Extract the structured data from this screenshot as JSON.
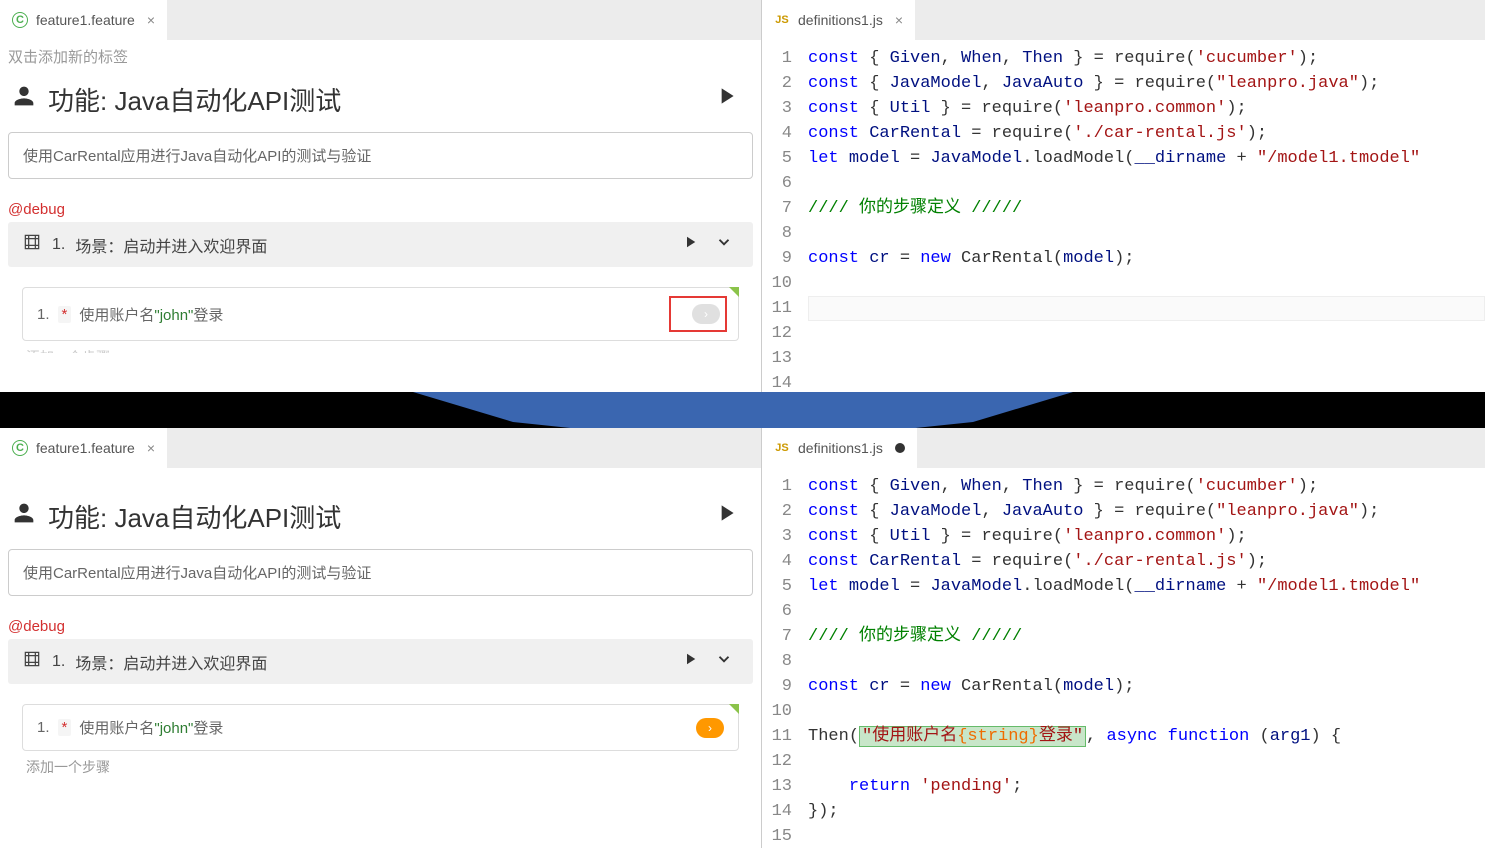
{
  "tabs": {
    "left": {
      "label": "feature1.feature",
      "icon": "cucumber"
    },
    "right_top": {
      "label": "definitions1.js",
      "icon": "js",
      "modified": false
    },
    "right_bottom": {
      "label": "definitions1.js",
      "icon": "js",
      "modified": true
    }
  },
  "feature": {
    "tag_hint": "双击添加新的标签",
    "title_prefix": "功能: ",
    "title": "Java自动化API测试",
    "description": "使用CarRental应用进行Java自动化API的测试与验证",
    "debug_tag": "@debug"
  },
  "scenario": {
    "number": "1.",
    "label_prefix": "场景：",
    "label": "启动并进入欢迎界面"
  },
  "step": {
    "number": "1.",
    "star": "*",
    "text_before": "使用账户名",
    "param": "\"john\"",
    "text_after": "登录",
    "add_step": "添加一个步骤"
  },
  "code_top": {
    "lines": [
      {
        "n": 1,
        "html": "<span class='kw'>const</span> { <span class='id'>Given</span>, <span class='id'>When</span>, <span class='id'>Then</span> } = <span class='fn'>require</span>(<span class='str'>'cucumber'</span>);"
      },
      {
        "n": 2,
        "html": "<span class='kw'>const</span> { <span class='id'>JavaModel</span>, <span class='id'>JavaAuto</span> } = <span class='fn'>require</span>(<span class='str2'>\"leanpro.java\"</span>);"
      },
      {
        "n": 3,
        "html": "<span class='kw'>const</span> { <span class='id'>Util</span> } = <span class='fn'>require</span>(<span class='str'>'leanpro.common'</span>);"
      },
      {
        "n": 4,
        "html": "<span class='kw'>const</span> <span class='id'>CarRental</span> = <span class='fn'>require</span>(<span class='str'>'./car-rental.js'</span>);"
      },
      {
        "n": 5,
        "html": "<span class='kw'>let</span> <span class='id'>model</span> = <span class='id'>JavaModel</span>.<span class='fn'>loadModel</span>(<span class='id'>__dirname</span> + <span class='str2'>\"/model1.tmodel\"</span>"
      },
      {
        "n": 6,
        "html": ""
      },
      {
        "n": 7,
        "html": "<span class='cm'>//// 你的步骤定义 /////</span>"
      },
      {
        "n": 8,
        "html": ""
      },
      {
        "n": 9,
        "html": "<span class='kw'>const</span> <span class='id'>cr</span> = <span class='kw'>new</span> <span class='fn'>CarRental</span>(<span class='id'>model</span>);"
      },
      {
        "n": 10,
        "html": ""
      },
      {
        "n": 11,
        "html": "",
        "cursor": true
      },
      {
        "n": 12,
        "html": ""
      },
      {
        "n": 13,
        "html": ""
      },
      {
        "n": 14,
        "html": ""
      }
    ]
  },
  "code_bottom": {
    "lines": [
      {
        "n": 1,
        "html": "<span class='kw'>const</span> { <span class='id'>Given</span>, <span class='id'>When</span>, <span class='id'>Then</span> } = <span class='fn'>require</span>(<span class='str'>'cucumber'</span>);"
      },
      {
        "n": 2,
        "html": "<span class='kw'>const</span> { <span class='id'>JavaModel</span>, <span class='id'>JavaAuto</span> } = <span class='fn'>require</span>(<span class='str2'>\"leanpro.java\"</span>);"
      },
      {
        "n": 3,
        "html": "<span class='kw'>const</span> { <span class='id'>Util</span> } = <span class='fn'>require</span>(<span class='str'>'leanpro.common'</span>);"
      },
      {
        "n": 4,
        "html": "<span class='kw'>const</span> <span class='id'>CarRental</span> = <span class='fn'>require</span>(<span class='str'>'./car-rental.js'</span>);"
      },
      {
        "n": 5,
        "html": "<span class='kw'>let</span> <span class='id'>model</span> = <span class='id'>JavaModel</span>.<span class='fn'>loadModel</span>(<span class='id'>__dirname</span> + <span class='str2'>\"/model1.tmodel\"</span>"
      },
      {
        "n": 6,
        "html": ""
      },
      {
        "n": 7,
        "html": "<span class='cm'>//// 你的步骤定义 /////</span>"
      },
      {
        "n": 8,
        "html": ""
      },
      {
        "n": 9,
        "html": "<span class='kw'>const</span> <span class='id'>cr</span> = <span class='kw'>new</span> <span class='fn'>CarRental</span>(<span class='id'>model</span>);"
      },
      {
        "n": 10,
        "html": ""
      },
      {
        "n": 11,
        "html": "<span class='fn'>Then</span>(<span class='hl-step'><span class='str'>\"使用账户名<span class='hl-param'>{string}</span>登录\"</span></span>, <span class='kw'>async function</span> (<span class='id'>arg1</span>) {"
      },
      {
        "n": 12,
        "html": ""
      },
      {
        "n": 13,
        "html": "    <span class='kw'>return</span> <span class='str'>'pending'</span>;"
      },
      {
        "n": 14,
        "html": "});"
      },
      {
        "n": 15,
        "html": ""
      }
    ]
  }
}
